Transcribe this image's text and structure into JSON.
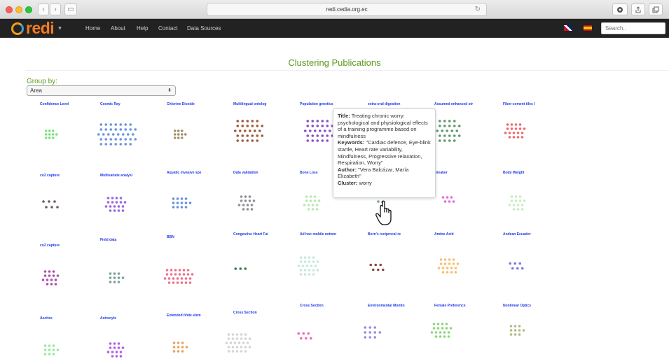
{
  "browser": {
    "url": "redi.cedia.org.ec",
    "back_glyph": "‹",
    "forward_glyph": "›",
    "sidebar_glyph": "▭",
    "reload_glyph": "↻",
    "icons": [
      "back-icon",
      "forward-icon",
      "sidebar-icon",
      "reload-icon",
      "extension-icon",
      "share-icon",
      "tabs-icon"
    ]
  },
  "navbar": {
    "logo": "redi",
    "caret": "▾",
    "links": [
      "Home",
      "About",
      "Help",
      "Contact",
      "Data Sources"
    ],
    "search_placeholder": "Search.."
  },
  "page": {
    "title": "Clustering Publications",
    "group_by_label": "Group by:",
    "group_by_value": "Area",
    "select_arrows": "⬍"
  },
  "clusters": [
    {
      "label": "Confidence Level",
      "color": "#7be37b"
    },
    {
      "label": "Cosmic Ray",
      "color": "#6a95df"
    },
    {
      "label": "Chlorine Dioxide",
      "color": "#a3906a"
    },
    {
      "label": "Multilingual ontolog",
      "color": "#a05a3b"
    },
    {
      "label": "Population genetics",
      "color": "#8a4fc9"
    },
    {
      "label": "extra-oral digestion",
      "color": "#5a4a8a"
    },
    {
      "label": "Assumed enhanced str",
      "color": "#5f9a6a"
    },
    {
      "label": "Fiber-cement tiles I",
      "color": "#ee6b6b"
    },
    {
      "label": "co2 capture",
      "color": "#6b5a6b"
    },
    {
      "label": "Multivariate analysi",
      "color": "#9a66dd"
    },
    {
      "label": "Aquatic invasive spe",
      "color": "#6a8fe0"
    },
    {
      "label": "Data validation",
      "color": "#8f8f98"
    },
    {
      "label": "Bone Loss",
      "color": "#b8eab0"
    },
    {
      "label": "",
      "color": "#2f5f3f"
    },
    {
      "label": "Breaker",
      "color": "#e66be0"
    },
    {
      "label": "Body Weight",
      "color": "#c8ecc0"
    },
    {
      "label": "co2 capture",
      "color": "#b04faa"
    },
    {
      "label": "Field data",
      "color": "#7aa09a"
    },
    {
      "label": "BBN",
      "color": "#ef6f8c"
    },
    {
      "label": "Congestive Heart Fai",
      "color": "#3d7a4a"
    },
    {
      "label": "Ad hoc mobile networ",
      "color": "#c8e6dc"
    },
    {
      "label": "Born's reciprocal re",
      "color": "#8a4646"
    },
    {
      "label": "Amino Acid",
      "color": "#f6c070"
    },
    {
      "label": "Andean Ecuador",
      "color": "#7a78dd"
    },
    {
      "label": "Ascites",
      "color": "#98ea9c"
    },
    {
      "label": "Astrocyte",
      "color": "#b25fe3"
    },
    {
      "label": "Extended finite elem",
      "color": "#e7a25f"
    },
    {
      "label": "Cross Section",
      "color": "#d4d4d4"
    },
    {
      "label": "Cross Section",
      "color": "#ee67b6"
    },
    {
      "label": "Environmental Monito",
      "color": "#9a8ae0"
    },
    {
      "label": "Female Preference",
      "color": "#8ed67e"
    },
    {
      "label": "Nonlinear Optics",
      "color": "#b5b889"
    }
  ],
  "tooltip": {
    "title_label": "Title:",
    "title": "Treating chronic worry: psychological and physiological effects of a training programme based on mindfulness",
    "keywords_label": "Keywords:",
    "keywords": "\"Cardiac defence, Eye-blink startle, Heart rate variability, Mindfulness, Progressive relaxation, Respiration, Worry\"",
    "author_label": "Author:",
    "author": "\"Vera Balcázar, María Elizabeth\"",
    "cluster_label": "Cluster:",
    "cluster": "worry"
  },
  "cursor_icon": "hand-pointer-icon"
}
